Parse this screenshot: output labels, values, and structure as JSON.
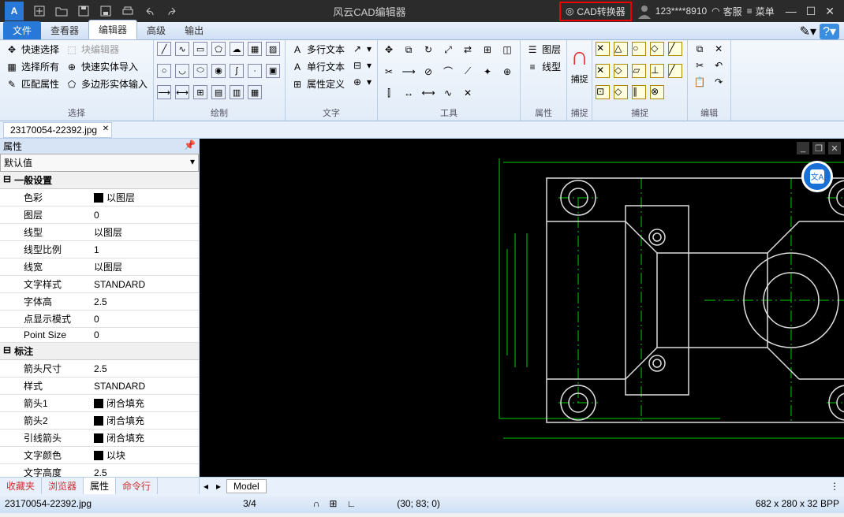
{
  "titlebar": {
    "title": "风云CAD编辑器",
    "converter": "CAD转换器",
    "user": "123****8910",
    "support": "客服",
    "menu": "菜单"
  },
  "menutabs": {
    "file": "文件",
    "viewer": "查看器",
    "editor": "编辑器",
    "advanced": "高级",
    "output": "输出"
  },
  "ribbon": {
    "select": {
      "quick": "快速选择",
      "all": "选择所有",
      "match": "匹配属性",
      "quickedit": "块编辑器",
      "solid_import": "快速实体导入",
      "poly_solid": "多边形实体输入",
      "label": "选择"
    },
    "draw_label": "绘制",
    "text": {
      "multi": "多行文本",
      "single": "单行文本",
      "attrdef": "属性定义",
      "label": "文字"
    },
    "tools_label": "工具",
    "props": {
      "layer": "图层",
      "linetype": "线型",
      "label": "属性"
    },
    "snap": "捕捉",
    "snap_label": "捕捉",
    "edit_label": "编辑"
  },
  "filetab": "23170054-22392.jpg",
  "properties": {
    "title": "属性",
    "default": "默认值",
    "section_general": "一般设置",
    "rows_general": [
      {
        "k": "色彩",
        "v": "以图层",
        "sw": true
      },
      {
        "k": "图层",
        "v": "0"
      },
      {
        "k": "线型",
        "v": "以图层"
      },
      {
        "k": "线型比例",
        "v": "1"
      },
      {
        "k": "线宽",
        "v": "以图层"
      },
      {
        "k": "文字样式",
        "v": "STANDARD"
      },
      {
        "k": "字体高",
        "v": "2.5"
      },
      {
        "k": "点显示模式",
        "v": "0"
      },
      {
        "k": "Point Size",
        "v": "0"
      }
    ],
    "section_annot": "标注",
    "rows_annot": [
      {
        "k": "箭头尺寸",
        "v": "2.5"
      },
      {
        "k": "样式",
        "v": "STANDARD"
      },
      {
        "k": "箭头1",
        "v": "闭合填充",
        "sw": true
      },
      {
        "k": "箭头2",
        "v": "闭合填充",
        "sw": true
      },
      {
        "k": "引线箭头",
        "v": "闭合填充",
        "sw": true
      },
      {
        "k": "文字颜色",
        "v": "以块",
        "sw": true
      },
      {
        "k": "文字高度",
        "v": "2.5"
      }
    ]
  },
  "bottomtabs": {
    "fav": "收藏夹",
    "browser": "浏览器",
    "props": "属性",
    "cmd": "命令行",
    "model": "Model"
  },
  "statusbar": {
    "file": "23170054-22392.jpg",
    "pages": "3/4",
    "coords": "(30; 83; 0)",
    "dims": "682 x 280 x 32 BPP"
  }
}
